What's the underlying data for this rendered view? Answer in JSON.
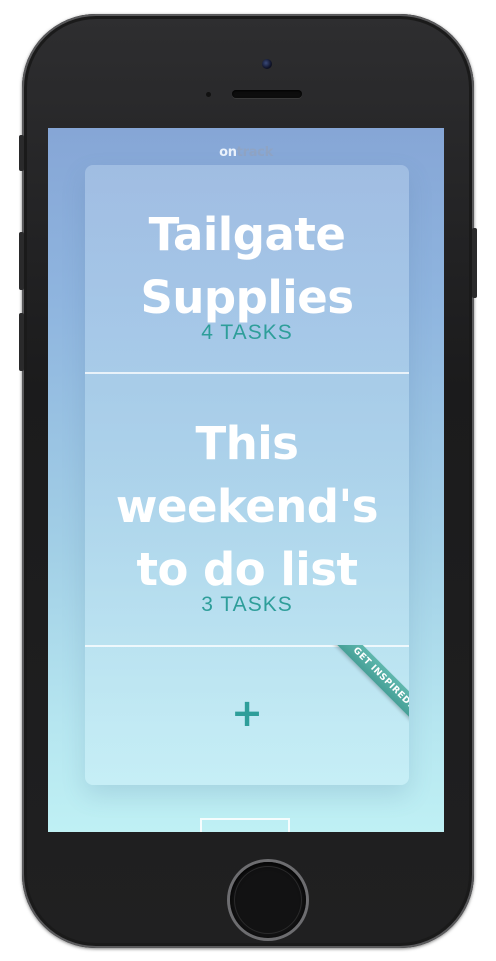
{
  "app": {
    "logo_on": "on",
    "logo_track": "track"
  },
  "lists": [
    {
      "title_lines": [
        "Tailgate",
        "Supplies"
      ],
      "count": "4 TASKS"
    },
    {
      "title_lines": [
        "This",
        "weekend's",
        "to do list"
      ],
      "count": "3 TASKS"
    }
  ],
  "actions": {
    "add_symbol": "+",
    "ribbon_label": "GET INSPIRED!"
  },
  "colors": {
    "accent": "#2e9e9a",
    "ribbon": "#4fa89f",
    "bg_top": "#86a6d6",
    "bg_bottom": "#bff0f4"
  }
}
